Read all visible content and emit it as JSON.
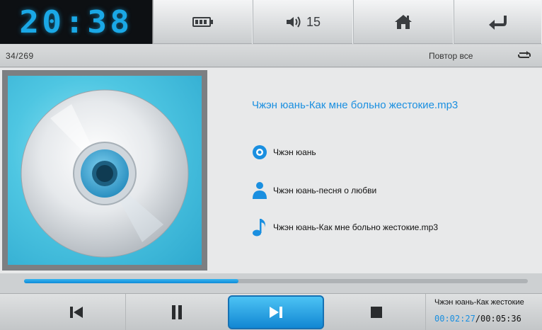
{
  "topbar": {
    "clock": "20:38",
    "volume": "15",
    "icons": {
      "battery": "battery-icon",
      "volume": "speaker-icon",
      "home": "home-icon",
      "back": "back-arrow-icon"
    }
  },
  "status": {
    "track_count": "34/269",
    "repeat_mode": "Повтор все",
    "repeat_icon": "repeat-icon"
  },
  "track": {
    "title": "Чжэн юань-Как мне больно жестокие.mp3",
    "artist": "Чжэн юань",
    "album": "Чжэн юань-песня о любви",
    "file": "Чжэн юань-Как мне больно жестокие.mp3"
  },
  "progress": {
    "fraction": 0.425
  },
  "now_playing": {
    "title": "Чжэн юань-Как жестокие",
    "elapsed": "00:02:27",
    "separator": "/",
    "total": "00:05:36"
  },
  "colors": {
    "accent": "#1a8fe0",
    "clock": "#1aa8e6"
  }
}
